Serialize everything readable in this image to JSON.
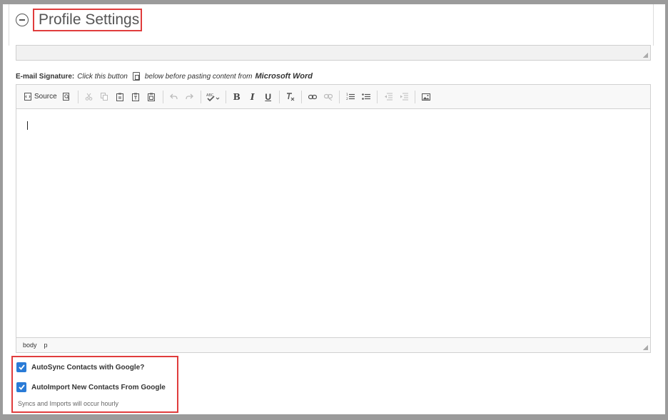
{
  "header": {
    "title": "Profile Settings"
  },
  "signature": {
    "label": "E-mail Signature:",
    "hint_before": "Click this button",
    "hint_after": "below before pasting content from",
    "hint_app": "Microsoft Word"
  },
  "toolbar": {
    "source_label": "Source",
    "bold_label": "B",
    "italic_label": "I",
    "underline_label": "U"
  },
  "editor": {
    "path": [
      "body",
      "p"
    ]
  },
  "options": {
    "autosync_label": "AutoSync Contacts with Google?",
    "autosync_checked": true,
    "autoimport_label": "AutoImport New Contacts From Google",
    "autoimport_checked": true,
    "note": "Syncs and Imports will occur hourly"
  },
  "colors": {
    "accent": "#2a7bd6",
    "highlight": "#e03c3c"
  }
}
